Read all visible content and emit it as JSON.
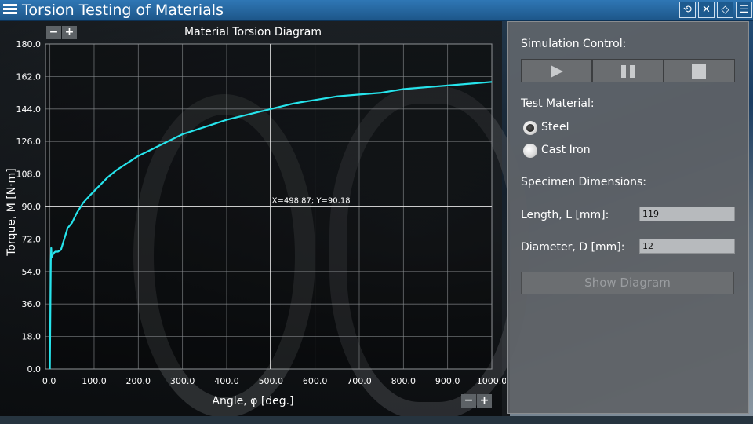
{
  "app": {
    "title": "Torsion Testing of Materials"
  },
  "toolbar_icons": [
    "reset-icon",
    "mute-icon",
    "notebook-icon",
    "info-list-icon"
  ],
  "zoom": {
    "minus": "−",
    "plus": "+"
  },
  "crosshair_readout": "X=498.87; Y=90.18",
  "panel": {
    "simulation_label": "Simulation Control:",
    "material_label": "Test Material:",
    "materials": [
      {
        "label": "Steel",
        "selected": true
      },
      {
        "label": "Cast Iron",
        "selected": false
      }
    ],
    "dimensions_label": "Specimen Dimensions:",
    "length_label": "Length, L [mm]:",
    "length_value": "119",
    "diameter_label": "Diameter, D [mm]:",
    "diameter_value": "12",
    "show_diagram": "Show Diagram"
  },
  "chart_data": {
    "type": "line",
    "title": "Material Torsion Diagram",
    "xlabel": "Angle, φ [deg.]",
    "ylabel": "Torque, M [N·m]",
    "xlim": [
      -10,
      1000
    ],
    "ylim": [
      0,
      180
    ],
    "x_ticks": [
      "0.0",
      "100.0",
      "200.0",
      "300.0",
      "400.0",
      "500.0",
      "600.0",
      "700.0",
      "800.0",
      "900.0",
      "1000.0"
    ],
    "y_ticks": [
      "0.0",
      "18.0",
      "36.0",
      "54.0",
      "72.0",
      "90.0",
      "108.0",
      "126.0",
      "144.0",
      "162.0",
      "180.0"
    ],
    "grid": true,
    "line_color": "#26e4ec",
    "crosshair": {
      "x": 498.87,
      "y": 90.18
    },
    "series": [
      {
        "x": [
          0,
          1,
          2,
          3,
          4,
          8,
          12,
          18,
          25,
          30,
          40,
          50,
          60,
          75,
          90,
          110,
          130,
          150,
          175,
          200,
          225,
          250,
          275,
          300,
          350,
          400,
          450,
          500,
          550,
          600,
          650,
          700,
          750,
          800,
          850,
          900,
          950,
          1000
        ],
        "values": [
          0,
          30,
          60,
          67,
          62,
          64,
          65,
          65,
          66,
          70,
          78,
          81,
          86,
          92,
          96,
          101,
          106,
          110,
          114,
          118,
          121,
          124,
          127,
          130,
          134,
          138,
          141,
          144,
          147,
          149,
          151,
          152,
          153,
          155,
          156,
          157,
          158,
          159
        ]
      }
    ]
  }
}
